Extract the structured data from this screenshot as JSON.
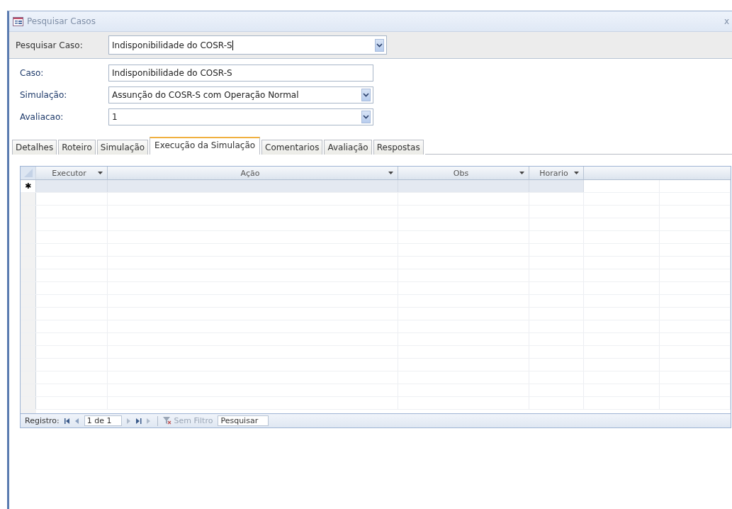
{
  "window": {
    "title": "Pesquisar Casos",
    "close": "x"
  },
  "search": {
    "label": "Pesquisar Caso:",
    "value": "Indisponibilidade do COSR-S"
  },
  "fields": [
    {
      "kind": "text",
      "label": "Caso:",
      "value": "Indisponibilidade do COSR-S"
    },
    {
      "kind": "combo",
      "label": "Simulação:",
      "value": "Assunção do COSR-S com Operação Normal"
    },
    {
      "kind": "combo",
      "label": "Avaliacao:",
      "value": "1"
    }
  ],
  "tabs": [
    {
      "label": "Detalhes",
      "selected": false
    },
    {
      "label": "Roteiro",
      "selected": false
    },
    {
      "label": "Simulação",
      "selected": false
    },
    {
      "label": "Execução da Simulação",
      "selected": true
    },
    {
      "label": "Comentarios",
      "selected": false
    },
    {
      "label": "Avaliação",
      "selected": false
    },
    {
      "label": "Respostas",
      "selected": false
    }
  ],
  "table": {
    "columns": [
      "Executor",
      "Ação",
      "Obs",
      "Horario"
    ],
    "new_row_marker": "✱"
  },
  "navigator": {
    "label": "Registro:",
    "position": "1 de 1",
    "filter": "Sem Filtro",
    "search": "Pesquisar"
  }
}
